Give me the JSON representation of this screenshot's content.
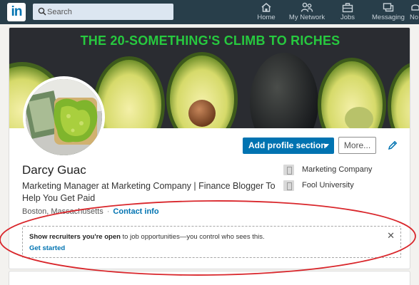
{
  "nav": {
    "logo": "in",
    "search_placeholder": "Search",
    "items": [
      {
        "label": "Home",
        "icon": "home-icon"
      },
      {
        "label": "My Network",
        "icon": "network-icon"
      },
      {
        "label": "Jobs",
        "icon": "briefcase-icon"
      },
      {
        "label": "Messaging",
        "icon": "messaging-icon"
      },
      {
        "label": "No",
        "icon": "bell-icon"
      }
    ]
  },
  "banner": {
    "title": "THE 20-SOMETHING'S CLIMB TO RICHES",
    "title_color": "#27c93f"
  },
  "profile": {
    "name": "Darcy Guac",
    "headline": "Marketing Manager at Marketing Company | Finance Blogger To Help You Get Paid",
    "location": "Boston, Massachusetts",
    "contact_link": "Contact info",
    "company": "Marketing Company",
    "school": "Fool University"
  },
  "actions": {
    "add_section": "Add profile section",
    "more": "More..."
  },
  "notice": {
    "bold": "Show recruiters you're open",
    "rest": " to job opportunities—you control who sees this.",
    "cta": "Get started"
  },
  "colors": {
    "nav_bg": "#283e4a",
    "primary": "#0073b1",
    "annotation": "#d9262b"
  }
}
